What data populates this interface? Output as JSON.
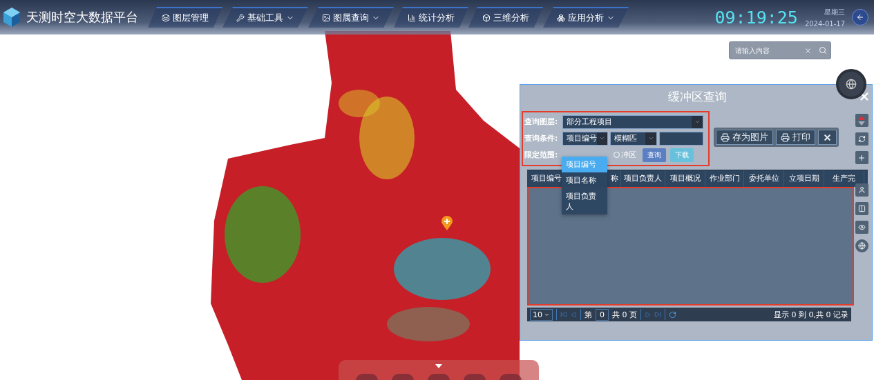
{
  "header": {
    "title": "天测时空大数据平台",
    "nav": [
      {
        "label": "图层管理",
        "has_menu": false
      },
      {
        "label": "基础工具",
        "has_menu": true
      },
      {
        "label": "图属查询",
        "has_menu": true
      },
      {
        "label": "统计分析",
        "has_menu": false
      },
      {
        "label": "三维分析",
        "has_menu": false
      },
      {
        "label": "应用分析",
        "has_menu": true
      }
    ],
    "clock": {
      "time": "09:19:25",
      "weekday": "星期三",
      "date": "2024-01-17"
    }
  },
  "search": {
    "placeholder": "请输入内容"
  },
  "panel": {
    "title": "缓冲区查询",
    "form": {
      "layer_label": "查询图层:",
      "layer_value": "部分工程项目",
      "condition_label": "查询条件:",
      "field_value": "项目编号",
      "match_value": "模糊匹",
      "scope_label": "限定范围:",
      "scope_options": [
        {
          "label": "冲区",
          "selected": false
        }
      ],
      "query_button": "查询",
      "download_button": "下载"
    },
    "field_dropdown": [
      {
        "label": "项目编号",
        "selected": true
      },
      {
        "label": "项目名称",
        "selected": false
      },
      {
        "label": "项目负责人",
        "selected": false
      }
    ],
    "toolbar": [
      "存为图片",
      "打印"
    ],
    "table": {
      "columns": [
        "项目编号",
        "称",
        "项目负责人",
        "项目概况",
        "作业部门",
        "委托单位",
        "立项日期",
        "生产完"
      ]
    },
    "pagination": {
      "page_size": "10",
      "page_prefix": "第",
      "page": "0",
      "page_total": "共 0 页",
      "summary": "显示 0 到 0,共 0 记录"
    }
  }
}
